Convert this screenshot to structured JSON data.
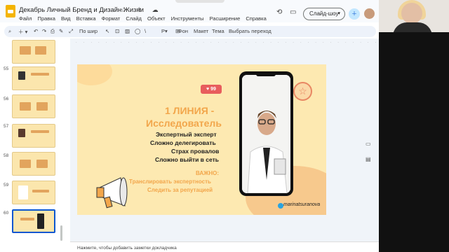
{
  "app": {
    "doc_title": "Декабрь Личный Бренд и Дизайн Жизни",
    "menu": [
      "Файл",
      "Правка",
      "Вид",
      "Вставка",
      "Формат",
      "Слайд",
      "Объект",
      "Инструменты",
      "Расширение",
      "Справка"
    ],
    "slideshow_label": "Слайд-шоу"
  },
  "toolbar": {
    "fit_label": "По шир",
    "background_label": "Фон",
    "layout_label": "Макет",
    "theme_label": "Тема",
    "transition_label": "Выбрать переход"
  },
  "thumbnails": [
    "55",
    "56",
    "57",
    "58",
    "59",
    "60"
  ],
  "slide": {
    "likes": "99",
    "heading_line1": "1 ЛИНИЯ -",
    "heading_line2": "Исследователь",
    "lines": [
      "Экспертный эксперт",
      "Сложно делегировать",
      "Страх провалов",
      "Сложно выйти в сеть"
    ],
    "important": "ВАЖНО:",
    "notes": [
      "Транслировать экспертность",
      "Следить за репутацией"
    ],
    "handle": "marinatsuranova"
  },
  "speaker_notes": "Нажмите, чтобы добавить заметки докладчика",
  "colors": {
    "accent": "#f2a64b",
    "slide_bg": "#fde9b1",
    "brand": "#0b57d0"
  }
}
